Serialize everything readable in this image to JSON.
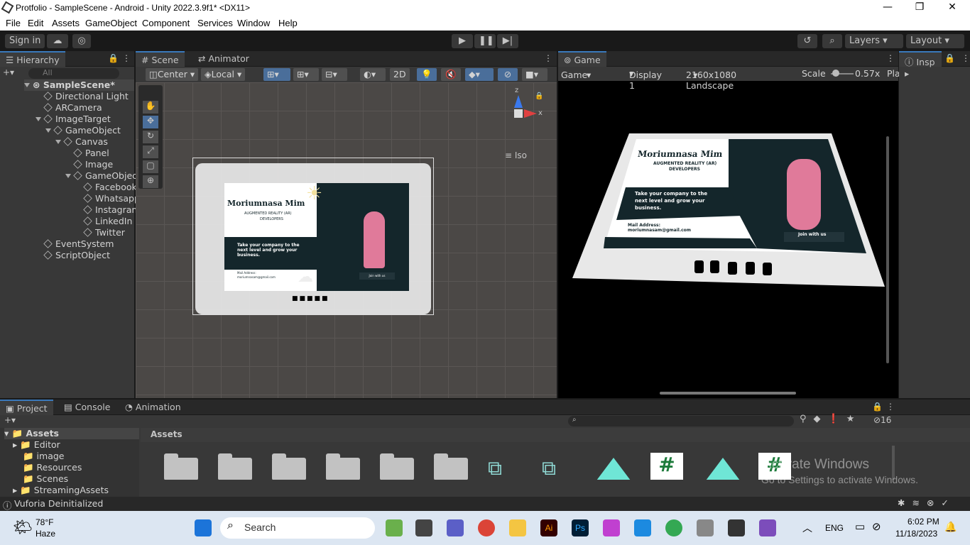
{
  "window": {
    "title": "Protfolio - SampleScene - Android - Unity 2022.3.9f1* <DX11>"
  },
  "menu": [
    "File",
    "Edit",
    "Assets",
    "GameObject",
    "Component",
    "Services",
    "Window",
    "Help"
  ],
  "toolbar": {
    "sign_in": "Sign in",
    "layers": "Layers",
    "layout": "Layout"
  },
  "hierarchy": {
    "tab": "Hierarchy",
    "search_placeholder": "All",
    "scene": "SampleScene*",
    "items": [
      "Directional Light",
      "ARCamera",
      "ImageTarget",
      "GameObject",
      "Canvas",
      "Panel",
      "Image",
      "GameObjec",
      "Facebook",
      "Whatsapp",
      "Instagram",
      "LinkedIn",
      "Twitter",
      "EventSystem",
      "ScriptObject"
    ]
  },
  "scene": {
    "tab": "Scene",
    "tab2": "Animator",
    "center": "Center",
    "local": "Local",
    "mode2d": "2D",
    "iso": "Iso",
    "axis_y": "z",
    "axis_x": "x"
  },
  "game": {
    "tab": "Game",
    "mode": "Game",
    "display": "Display 1",
    "resolution": "2160x1080 Landscape",
    "scale_label": "Scale",
    "scale_value": "0.57x",
    "play": "Pla"
  },
  "inspector": {
    "tab": "Insp"
  },
  "card": {
    "name": "Moriumnasa Mim",
    "role": "AUGMENTED REALITY (AR)",
    "role2": "DEVELOPERS",
    "tagline": "Take your company to the next level and grow your business.",
    "mail_label": "Mail Address:",
    "mail": "moriumnasam@gmail.com",
    "join": "Join with us"
  },
  "project": {
    "tab": "Project",
    "tab2": "Console",
    "tab3": "Animation",
    "assets": "Assets",
    "count": "16",
    "tree": [
      "Editor",
      "image",
      "Resources",
      "Scenes",
      "StreamingAssets"
    ]
  },
  "watermark": {
    "line1": "Activate Windows",
    "line2": "Go to Settings to activate Windows."
  },
  "status": {
    "text": "Vuforia Deinitialized"
  },
  "taskbar": {
    "temp": "78°F",
    "weather": "Haze",
    "search": "Search",
    "lang": "ENG",
    "time": "6:02 PM",
    "date": "11/18/2023"
  },
  "colors": {
    "accent": "#3a79bb",
    "card_dark": "#14262b",
    "pink": "#e07a9a"
  }
}
